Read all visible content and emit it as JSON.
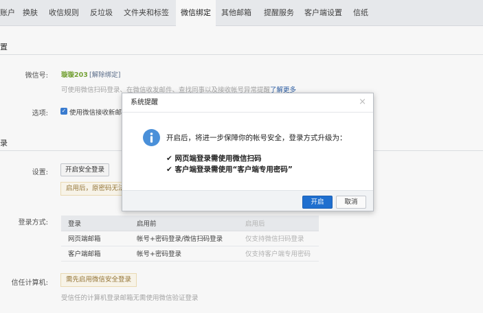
{
  "tabs": [
    "账户",
    "换肤",
    "收信规则",
    "反垃圾",
    "文件夹和标签",
    "微信绑定",
    "其他邮箱",
    "提醒服务",
    "客户端设置",
    "信纸"
  ],
  "sections": {
    "settings_head": "置",
    "login_head": "录"
  },
  "wechat": {
    "label": "微信号:",
    "name": "璇璇203",
    "unbind": "[解除绑定]",
    "desc": "可使用微信扫码登录、在微信收发邮件、查找同事以及接收帐号异常提醒",
    "learn_more": "了解更多"
  },
  "options": {
    "label": "选项:",
    "checkbox_text": "使用微信接收新邮件提醒"
  },
  "security": {
    "label": "设置:",
    "button": "开启安全登录",
    "notice": "启用后，原密码无法登录"
  },
  "login_method": {
    "label": "登录方式:",
    "headers": [
      "登录",
      "启用前",
      "启用后"
    ],
    "rows": [
      [
        "网页端邮箱",
        "帐号+密码登录/微信扫码登录",
        "仅支持微信扫码登录"
      ],
      [
        "客户端邮箱",
        "帐号+密码登录",
        "仅支持客户端专用密码"
      ]
    ]
  },
  "trusted": {
    "label": "信任计算机:",
    "notice": "需先启用微信安全登录",
    "desc": "受信任的计算机登录邮箱无需使用微信验证登录"
  },
  "dialog": {
    "title": "系统提醒",
    "close": "×",
    "message": "开启后，将进一步保障你的帐号安全，登录方式升级为：",
    "items": [
      "✔ 网页端登录需使用微信扫码",
      "✔ 客户端登录需使用“客户端专用密码”"
    ],
    "confirm": "开启",
    "cancel": "取消"
  }
}
